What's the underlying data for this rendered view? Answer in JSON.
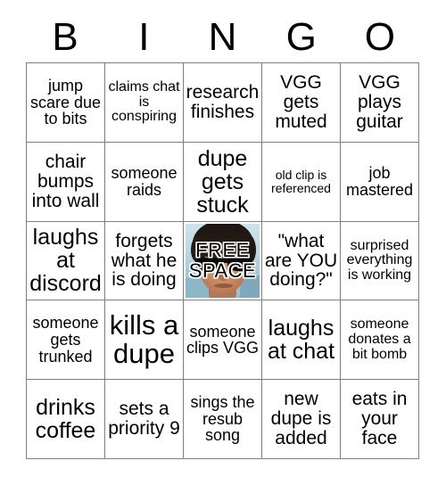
{
  "card": {
    "header_letters": [
      "B",
      "I",
      "N",
      "G",
      "O"
    ],
    "grid": {
      "columns": 5,
      "rows": 5,
      "cells": [
        {
          "text": "jump scare due to bits",
          "size": "fs-m",
          "name": "bingo-cell-b1"
        },
        {
          "text": "claims chat is conspiring",
          "size": "fs-s",
          "name": "bingo-cell-i1"
        },
        {
          "text": "research finishes",
          "size": "fs-l",
          "name": "bingo-cell-n1"
        },
        {
          "text": "VGG gets muted",
          "size": "fs-l",
          "name": "bingo-cell-g1"
        },
        {
          "text": "VGG plays guitar",
          "size": "fs-l",
          "name": "bingo-cell-o1"
        },
        {
          "text": "chair bumps into wall",
          "size": "fs-l",
          "name": "bingo-cell-b2"
        },
        {
          "text": "someone raids",
          "size": "fs-m",
          "name": "bingo-cell-i2"
        },
        {
          "text": "dupe gets stuck",
          "size": "fs-xl",
          "name": "bingo-cell-n2"
        },
        {
          "text": "old clip is referenced",
          "size": "fs-xs",
          "name": "bingo-cell-g2"
        },
        {
          "text": "job mastered",
          "size": "fs-m",
          "name": "bingo-cell-o2"
        },
        {
          "text": "laughs at discord",
          "size": "fs-xl",
          "name": "bingo-cell-b3"
        },
        {
          "text": "forgets what he is doing",
          "size": "fs-l",
          "name": "bingo-cell-i3"
        },
        {
          "text": "FREE SPACE",
          "size": "free",
          "name": "bingo-cell-free-space"
        },
        {
          "text": "\"what are YOU doing?\"",
          "size": "fs-l",
          "name": "bingo-cell-g3"
        },
        {
          "text": "surprised everything is working",
          "size": "fs-s",
          "name": "bingo-cell-o3"
        },
        {
          "text": "someone gets trunked",
          "size": "fs-m",
          "name": "bingo-cell-b4"
        },
        {
          "text": "kills a dupe",
          "size": "fs-xxl",
          "name": "bingo-cell-i4"
        },
        {
          "text": "someone clips VGG",
          "size": "fs-m",
          "name": "bingo-cell-n4"
        },
        {
          "text": "laughs at chat",
          "size": "fs-xl",
          "name": "bingo-cell-g4"
        },
        {
          "text": "someone donates a bit bomb",
          "size": "fs-s",
          "name": "bingo-cell-o4"
        },
        {
          "text": "drinks coffee",
          "size": "fs-xl",
          "name": "bingo-cell-b5"
        },
        {
          "text": "sets a priority 9",
          "size": "fs-l",
          "name": "bingo-cell-i5"
        },
        {
          "text": "sings the resub song",
          "size": "fs-m",
          "name": "bingo-cell-n5"
        },
        {
          "text": "new dupe is added",
          "size": "fs-l",
          "name": "bingo-cell-g5"
        },
        {
          "text": "eats in your face",
          "size": "fs-l",
          "name": "bingo-cell-o5"
        }
      ]
    },
    "free_space": {
      "line1": "FREE",
      "line2": "SPACE",
      "image_description": "photo-of-man-with-sunglasses"
    },
    "colors": {
      "background": "#ffffff",
      "text": "#000000",
      "grid_line": "#808080",
      "free_space_sky": "#bcd8e4",
      "free_space_skin": "#c98a64",
      "free_space_hair": "#241a14",
      "free_space_label_outline": "#ffffff"
    }
  }
}
